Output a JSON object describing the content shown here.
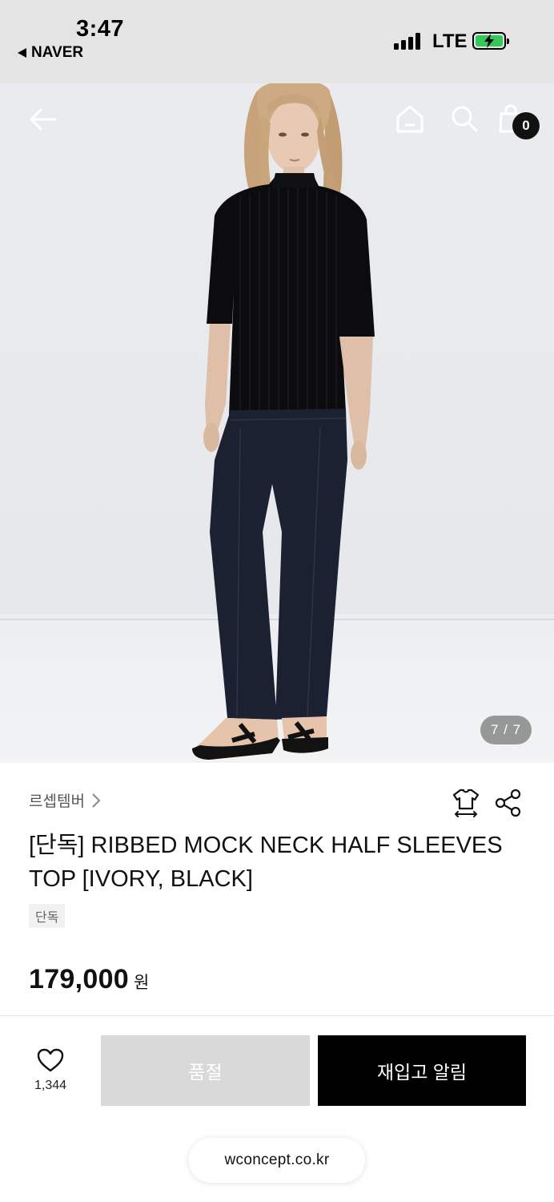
{
  "status_bar": {
    "time": "3:47",
    "back_app": "NAVER",
    "network": "LTE",
    "battery_color": "#35c759"
  },
  "hero": {
    "image_counter": "7 / 7",
    "cart_count": "0",
    "icons": [
      "back-arrow-icon",
      "home-icon",
      "search-icon",
      "shopping-bag-icon"
    ]
  },
  "product": {
    "brand": "르셉템버",
    "title": "[단독] RIBBED MOCK NECK HALF SLEEVES TOP [IVORY, BLACK]",
    "tag": "단독",
    "price": "179,000",
    "price_unit": "원"
  },
  "actions": {
    "like_count": "1,344",
    "soldout_label": "품절",
    "restock_label": "재입고 알림"
  },
  "browser": {
    "domain": "wconcept.co.kr"
  }
}
